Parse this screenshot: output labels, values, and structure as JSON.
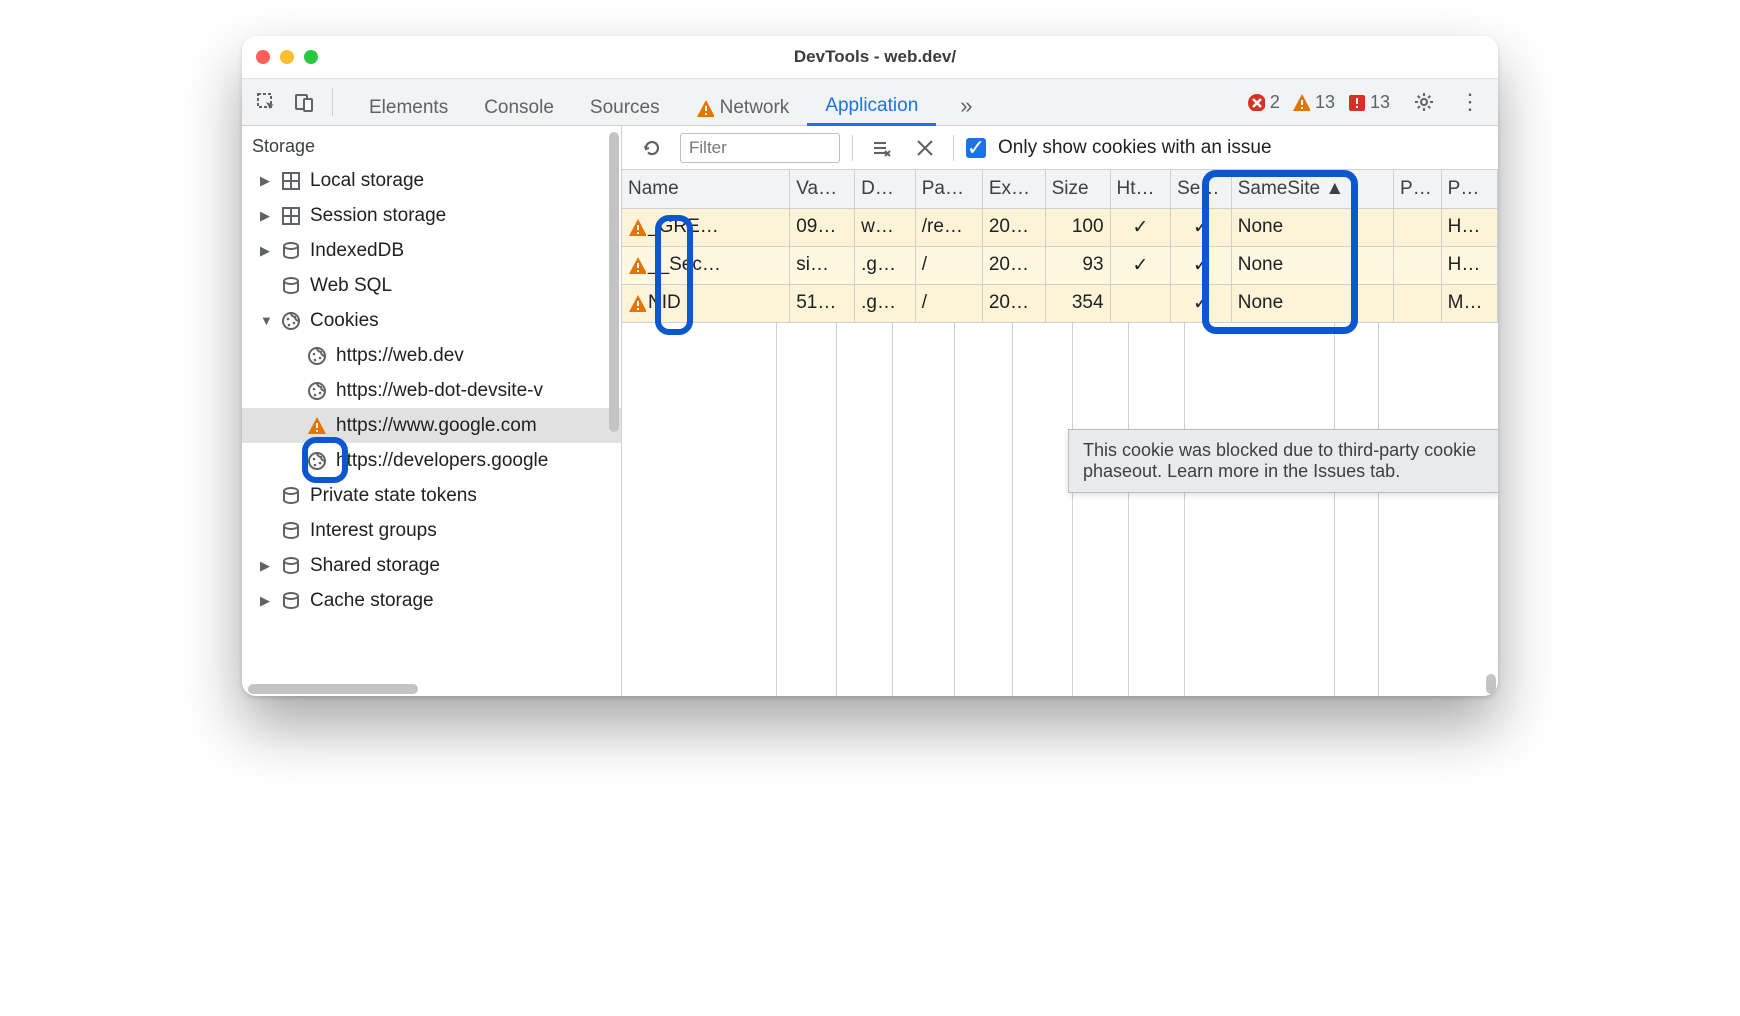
{
  "window": {
    "title": "DevTools - web.dev/"
  },
  "tabs": {
    "items": [
      "Elements",
      "Console",
      "Sources",
      "Network",
      "Application"
    ],
    "active": "Application",
    "warnings_on": "Network"
  },
  "counters": {
    "errors": "2",
    "warnings": "13",
    "issues": "13"
  },
  "sidebar": {
    "section": "Storage",
    "items": [
      {
        "label": "Local storage",
        "icon": "grid",
        "exp": true,
        "level": 1
      },
      {
        "label": "Session storage",
        "icon": "grid",
        "exp": true,
        "level": 1
      },
      {
        "label": "IndexedDB",
        "icon": "db",
        "exp": true,
        "level": 1
      },
      {
        "label": "Web SQL",
        "icon": "db",
        "exp": false,
        "level": 1
      },
      {
        "label": "Cookies",
        "icon": "cookie",
        "exp": true,
        "open": true,
        "level": 1
      },
      {
        "label": "https://web.dev",
        "icon": "cookie",
        "level": 2
      },
      {
        "label": "https://web-dot-devsite-v",
        "icon": "cookie",
        "level": 2
      },
      {
        "label": "https://www.google.com",
        "icon": "warning",
        "level": 2,
        "selected": true
      },
      {
        "label": "https://developers.google",
        "icon": "cookie",
        "level": 2
      },
      {
        "label": "Private state tokens",
        "icon": "db",
        "level": 1
      },
      {
        "label": "Interest groups",
        "icon": "db",
        "level": 1
      },
      {
        "label": "Shared storage",
        "icon": "db",
        "exp": true,
        "level": 1
      },
      {
        "label": "Cache storage",
        "icon": "db",
        "exp": true,
        "level": 1
      }
    ]
  },
  "toolbar": {
    "filter_placeholder": "Filter",
    "checkbox_label": "Only show cookies with an issue"
  },
  "table": {
    "headers": [
      "Name",
      "Va…",
      "D…",
      "Pa…",
      "Ex…",
      "Size",
      "Ht…",
      "Se…",
      "SameSite  ▲",
      "P…",
      "P…"
    ],
    "rows": [
      {
        "name": "_GRE…",
        "value": "09…",
        "domain": "w…",
        "path": "/re…",
        "expires": "20…",
        "size": "100",
        "http": "✓",
        "secure": "✓",
        "samesite": "None",
        "pk": "",
        "priority": "H…"
      },
      {
        "name": "__Sec…",
        "value": "si…",
        "domain": ".g…",
        "path": "/",
        "expires": "20…",
        "size": "93",
        "http": "✓",
        "secure": "✓",
        "samesite": "None",
        "pk": "",
        "priority": "H…"
      },
      {
        "name": "NID",
        "value": "51…",
        "domain": ".g…",
        "path": "/",
        "expires": "20…",
        "size": "354",
        "http": "",
        "secure": "✓",
        "samesite": "None",
        "pk": "",
        "priority": "M…"
      }
    ]
  },
  "tooltip": "This cookie was blocked due to third-party cookie phaseout. Learn more in the Issues tab."
}
